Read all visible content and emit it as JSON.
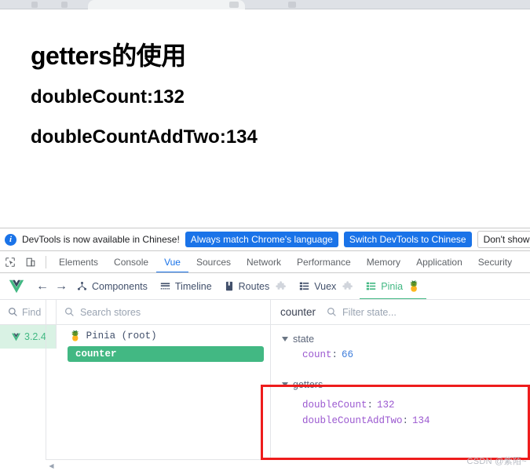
{
  "browser": {
    "tab_label": ""
  },
  "page": {
    "heading": "getters的使用",
    "line1": "doubleCount:132",
    "line2": "doubleCountAddTwo:134"
  },
  "notification": {
    "icon": "info-icon",
    "message": "DevTools is now available in Chinese!",
    "primary_button": "Always match Chrome's language",
    "secondary_button": "Switch DevTools to Chinese",
    "dismiss_button": "Don't show again"
  },
  "devtools_tabs": {
    "inspect_icon": "inspect-element-icon",
    "device_icon": "device-toolbar-icon",
    "items": [
      {
        "label": "Elements",
        "active": false
      },
      {
        "label": "Console",
        "active": false
      },
      {
        "label": "Vue",
        "active": true
      },
      {
        "label": "Sources",
        "active": false
      },
      {
        "label": "Network",
        "active": false
      },
      {
        "label": "Performance",
        "active": false
      },
      {
        "label": "Memory",
        "active": false
      },
      {
        "label": "Application",
        "active": false
      },
      {
        "label": "Security",
        "active": false
      }
    ]
  },
  "vue_toolbar": {
    "logo": "vue-logo-icon",
    "back": "arrow-left-icon",
    "forward": "arrow-right-icon",
    "items": [
      {
        "label": "Components",
        "icon": "component-tree-icon",
        "active": false,
        "plugin": false
      },
      {
        "label": "Timeline",
        "icon": "timeline-icon",
        "active": false,
        "plugin": false
      },
      {
        "label": "Routes",
        "icon": "routes-book-icon",
        "active": false,
        "plugin": true
      },
      {
        "label": "Vuex",
        "icon": "vuex-list-icon",
        "active": false,
        "plugin": true
      },
      {
        "label": "Pinia",
        "icon": "pinia-list-icon",
        "active": true,
        "plugin": false
      }
    ],
    "pinia_emoji": "🍍"
  },
  "left_panel": {
    "find_placeholder": "Find",
    "search_placeholder": "Search stores",
    "search_icon": "search-icon",
    "version": "3.2.4",
    "version_logo": "vue-logo-icon",
    "root_store": "Pinia (root)",
    "root_icon": "🍍",
    "selected_store": "counter",
    "scroll_left_icon": "scroll-left-arrow-icon"
  },
  "right_panel": {
    "title": "counter",
    "filter_placeholder": "Filter state...",
    "search_icon": "search-icon",
    "sections": [
      {
        "name": "state",
        "entries": [
          {
            "key": "count",
            "value": "66",
            "type": "number"
          }
        ]
      },
      {
        "name": "getters",
        "highlighted": true,
        "entries": [
          {
            "key": "doubleCount",
            "value": "132",
            "type": "number"
          },
          {
            "key": "doubleCountAddTwo",
            "value": "134",
            "type": "number"
          }
        ]
      }
    ],
    "highlight_color": "#ee1c1c"
  },
  "watermark": "CSDN @紫陌~",
  "colors": {
    "vue_green": "#42b883",
    "chrome_blue": "#1a73e8",
    "key_purple": "#9b59d0",
    "value_blue": "#3e7ddb",
    "annotation_red": "#ee1c1c"
  }
}
